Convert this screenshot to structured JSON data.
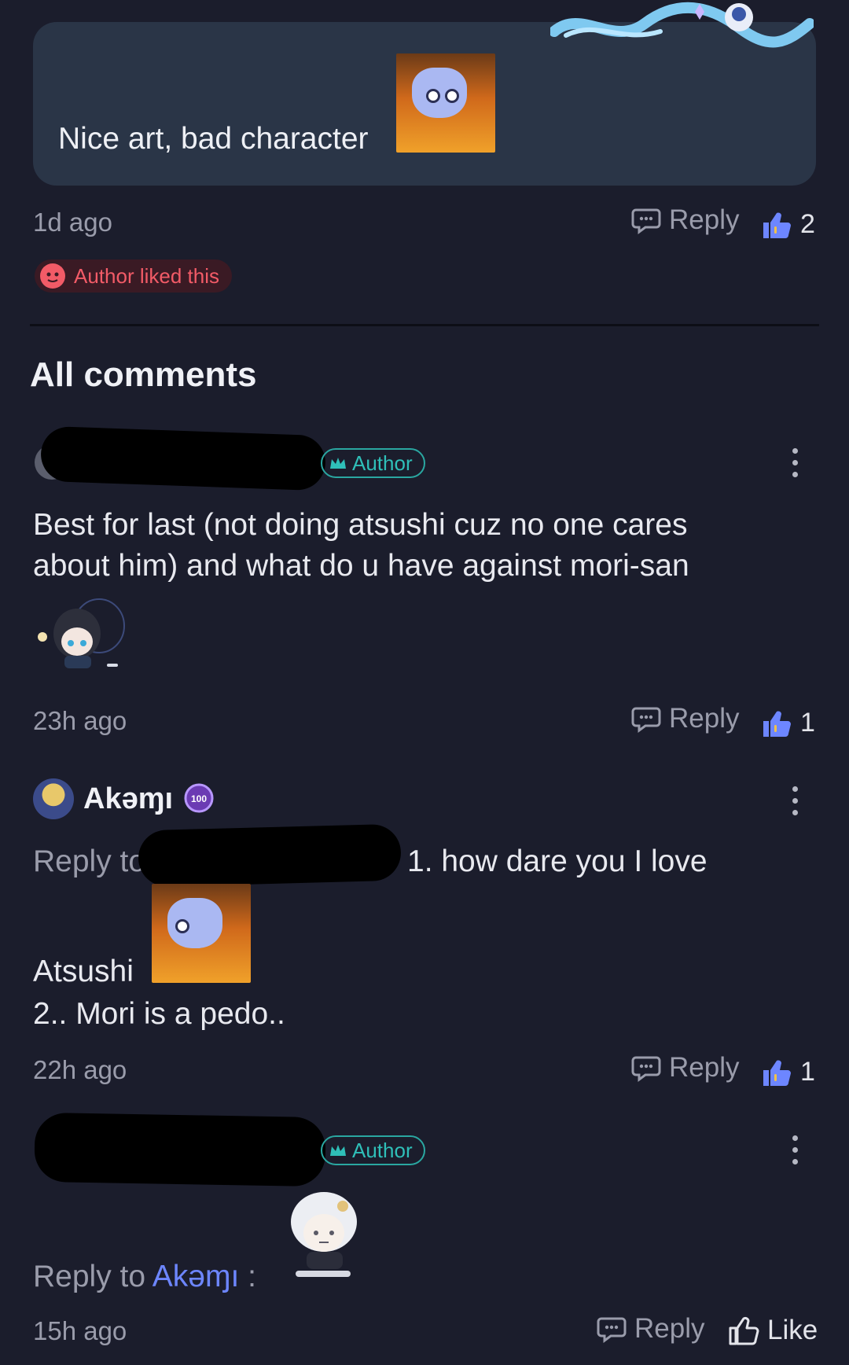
{
  "top_comment": {
    "text": "Nice art, bad character",
    "time": "1d ago",
    "reply_label": "Reply",
    "like_count": "2",
    "author_liked": "Author liked this"
  },
  "section_title": "All comments",
  "comments": [
    {
      "badge": "Author",
      "text_line1": "Best for last (not doing atsushi cuz no one cares",
      "text_line2": "about him) and what do u have against mori-san",
      "time": "23h ago",
      "reply_label": "Reply",
      "like_count": "1"
    },
    {
      "username": "Akəɱı",
      "reply_prefix": "Reply to",
      "text_part1": "1. how dare you I love",
      "text_part2": "Atsushi",
      "text_part3": "2.. Mori is a pedo..",
      "time": "22h ago",
      "reply_label": "Reply",
      "like_count": "1"
    },
    {
      "badge": "Author",
      "reply_prefix": "Reply to",
      "reply_target": "Akəɱı",
      "reply_colon": ":",
      "time": "15h ago",
      "reply_label": "Reply",
      "like_label": "Like"
    }
  ],
  "colors": {
    "background": "#1b1d2c",
    "bubble": "#2a3547",
    "like_blue": "#6d86ff",
    "author_teal": "#2fbfb8",
    "liked_red": "#f25b67"
  }
}
